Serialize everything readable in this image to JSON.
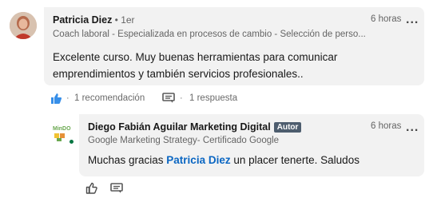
{
  "comment": {
    "author_name": "Patricia Diez",
    "degree": " • 1er",
    "headline": "Coach laboral - Especializada en procesos de cambio - Selección de perso...",
    "time": "6 horas",
    "more_label": "...",
    "text_line1": "Excelente curso.  Muy buenas herramientas para comunicar",
    "text_line2": "emprendimientos y también servicios profesionales..",
    "like_icon": "thumbs-up-icon",
    "reactions_label": "1 recomendación",
    "replies_label": "1 respuesta",
    "reply_icon": "comment-icon"
  },
  "reply": {
    "author_name": "Diego Fabián Aguilar Marketing Digital",
    "badge": "Autor",
    "headline": "Google Marketing Strategy- Certificado Google",
    "time": "6 horas",
    "more_label": "...",
    "text_before": "Muchas gracias ",
    "mention": "Patricia Diez",
    "text_after": " un placer tenerte. Saludos",
    "logo_text": "MinDO",
    "online_color": "#057642"
  },
  "colors": {
    "bubble": "#f2f2f2",
    "link": "#0a66c2",
    "like": "#378fe9",
    "badge": "#4d5d6e"
  }
}
